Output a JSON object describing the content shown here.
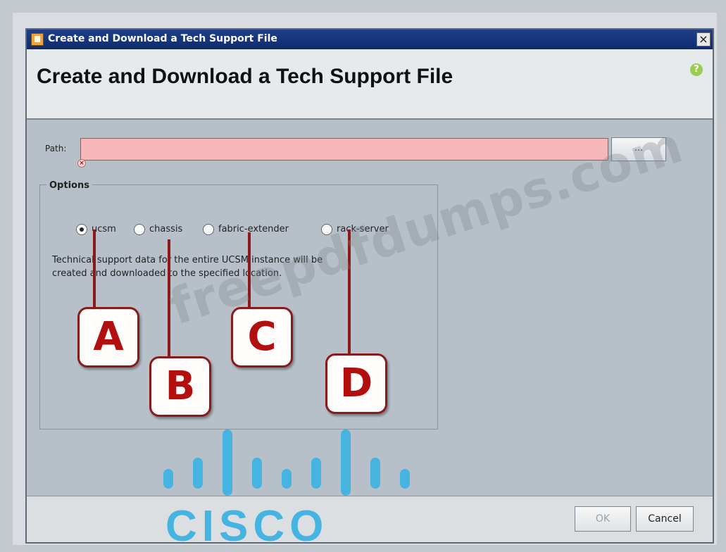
{
  "window": {
    "title": "Create and Download a Tech Support File",
    "close_symbol": "×"
  },
  "header": {
    "title": "Create and Download a Tech Support File",
    "help_icon": "?"
  },
  "path": {
    "label": "Path:",
    "value": "",
    "placeholder": "",
    "browse_label": "...",
    "error_icon": "×"
  },
  "options": {
    "legend": "Options",
    "radios": [
      {
        "label": "ucsm",
        "checked": true
      },
      {
        "label": "chassis",
        "checked": false
      },
      {
        "label": "fabric-extender",
        "checked": false
      },
      {
        "label": "rack-server",
        "checked": false
      }
    ],
    "description_line1": "Technical support data for the entire UCSM instance will be",
    "description_line2": "created and downloaded to the specified location."
  },
  "footer": {
    "ok_label": "OK",
    "cancel_label": "Cancel"
  },
  "callouts": [
    {
      "letter": "A"
    },
    {
      "letter": "B"
    },
    {
      "letter": "C"
    },
    {
      "letter": "D"
    }
  ],
  "watermark": "freepdfdumps.com",
  "logo": {
    "text": "CISCO",
    "color": "#46b4e0"
  }
}
